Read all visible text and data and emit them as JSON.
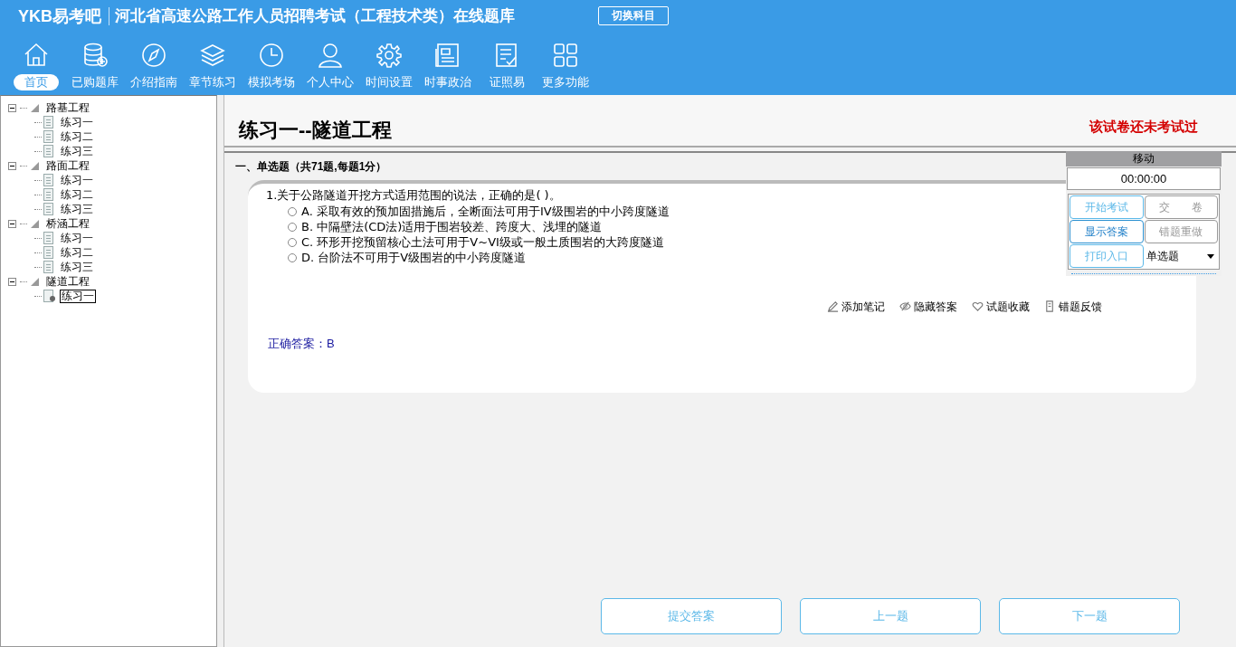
{
  "header": {
    "logo": "YKB易考吧",
    "title": "河北省高速公路工作人员招聘考试（工程技术类）在线题库",
    "switch_button": "切换科目"
  },
  "nav": [
    {
      "label": "首页",
      "selected": true
    },
    {
      "label": "已购题库",
      "selected": false
    },
    {
      "label": "介绍指南",
      "selected": false
    },
    {
      "label": "章节练习",
      "selected": false
    },
    {
      "label": "模拟考场",
      "selected": false
    },
    {
      "label": "个人中心",
      "selected": false
    },
    {
      "label": "时间设置",
      "selected": false
    },
    {
      "label": "时事政治",
      "selected": false
    },
    {
      "label": "证照易",
      "selected": false
    },
    {
      "label": "更多功能",
      "selected": false
    }
  ],
  "tree": [
    {
      "label": "路基工程",
      "expanded": true,
      "children": [
        {
          "label": "练习一",
          "selected": false
        },
        {
          "label": "练习二",
          "selected": false
        },
        {
          "label": "练习三",
          "selected": false
        }
      ]
    },
    {
      "label": "路面工程",
      "expanded": true,
      "children": [
        {
          "label": "练习一",
          "selected": false
        },
        {
          "label": "练习二",
          "selected": false
        },
        {
          "label": "练习三",
          "selected": false
        }
      ]
    },
    {
      "label": "桥涵工程",
      "expanded": true,
      "children": [
        {
          "label": "练习一",
          "selected": false
        },
        {
          "label": "练习二",
          "selected": false
        },
        {
          "label": "练习三",
          "selected": false
        }
      ]
    },
    {
      "label": "隧道工程",
      "expanded": true,
      "children": [
        {
          "label": "练习一",
          "selected": true
        }
      ]
    }
  ],
  "paper": {
    "title": "练习一--隧道工程",
    "status": "该试卷还未考试过"
  },
  "section": "一、单选题（共71题,每题1分）",
  "question": {
    "number": "1.",
    "text": "关于公路隧道开挖方式适用范围的说法，正确的是( )。",
    "options": [
      {
        "text": "A. 采取有效的预加固措施后，全断面法可用于IV级围岩的中小跨度隧道",
        "selected": false
      },
      {
        "text": "B. 中隔壁法(CD法)适用于围岩较差、跨度大、浅埋的隧道",
        "selected": false
      },
      {
        "text": "C. 环形开挖预留核心土法可用于V~VI级或一般土质围岩的大跨度隧道",
        "selected": false
      },
      {
        "text": "D. 台阶法不可用于V级围岩的中小跨度隧道",
        "selected": false
      }
    ],
    "tools": [
      "添加笔记",
      "隐藏答案",
      "试题收藏",
      "错题反馈"
    ],
    "answer": "正确答案：B"
  },
  "panel": {
    "move": "移动",
    "timer": "00:00:00",
    "buttons": [
      {
        "label": "开始考试",
        "kind": "light"
      },
      {
        "label": "交　　卷",
        "kind": "gray"
      },
      {
        "label": "显示答案",
        "kind": "strong"
      },
      {
        "label": "错题重做",
        "kind": "gray"
      },
      {
        "label": "打印入口",
        "kind": "light"
      }
    ],
    "type_select": "单选题"
  },
  "footer_buttons": [
    "提交答案",
    "上一题",
    "下一题"
  ]
}
